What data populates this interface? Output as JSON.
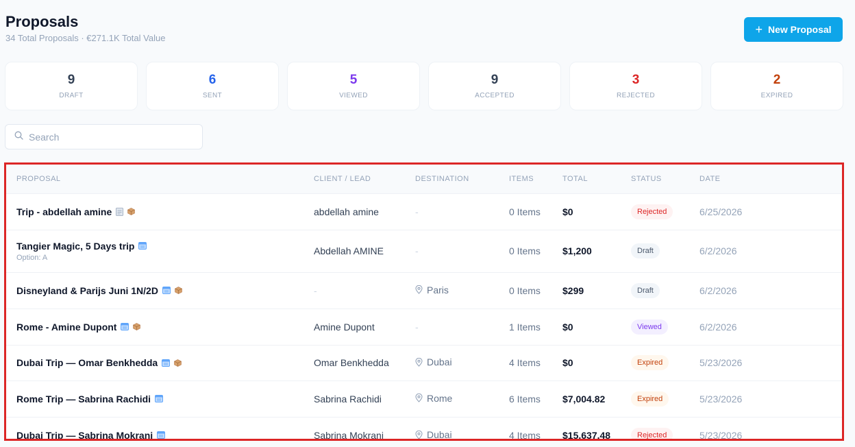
{
  "header": {
    "title": "Proposals",
    "subtitle": "34 Total Proposals · €271.1K Total Value",
    "new_button_label": "New Proposal",
    "new_button_icon": "plus-icon"
  },
  "stats": [
    {
      "value": "9",
      "label": "DRAFT",
      "color": "#334155"
    },
    {
      "value": "6",
      "label": "SENT",
      "color": "#2563eb"
    },
    {
      "value": "5",
      "label": "VIEWED",
      "color": "#7c3aed"
    },
    {
      "value": "9",
      "label": "ACCEPTED",
      "color": "#334155"
    },
    {
      "value": "3",
      "label": "REJECTED",
      "color": "#dc2626"
    },
    {
      "value": "2",
      "label": "EXPIRED",
      "color": "#c2410c"
    }
  ],
  "search": {
    "placeholder": "Search",
    "value": "",
    "icon": "search-icon"
  },
  "table": {
    "columns": [
      "PROPOSAL",
      "CLIENT / LEAD",
      "DESTINATION",
      "ITEMS",
      "TOTAL",
      "STATUS",
      "DATE"
    ],
    "rows": [
      {
        "name": "Trip - abdellah amine",
        "option": "",
        "icons": [
          "note-icon",
          "box-icon"
        ],
        "client": "abdellah amine",
        "destination": "-",
        "items": "0 Items",
        "total": "$0",
        "status": "Rejected",
        "date": "6/25/2026"
      },
      {
        "name": "Tangier Magic, 5 Days trip",
        "option": "Option: A",
        "icons": [
          "calendar-icon"
        ],
        "client": "Abdellah AMINE",
        "destination": "-",
        "items": "0 Items",
        "total": "$1,200",
        "status": "Draft",
        "date": "6/2/2026"
      },
      {
        "name": "Disneyland & Parijs Juni 1N/2D",
        "option": "",
        "icons": [
          "calendar-icon",
          "box-icon"
        ],
        "client": "-",
        "destination": "Paris",
        "items": "0 Items",
        "total": "$299",
        "status": "Draft",
        "date": "6/2/2026"
      },
      {
        "name": "Rome - Amine Dupont",
        "option": "",
        "icons": [
          "calendar-icon",
          "box-icon"
        ],
        "client": "Amine Dupont",
        "destination": "-",
        "items": "1 Items",
        "total": "$0",
        "status": "Viewed",
        "date": "6/2/2026"
      },
      {
        "name": "Dubai Trip — Omar Benkhedda",
        "option": "",
        "icons": [
          "calendar-icon",
          "box-icon"
        ],
        "client": "Omar Benkhedda",
        "destination": "Dubai",
        "items": "4 Items",
        "total": "$0",
        "status": "Expired",
        "date": "5/23/2026"
      },
      {
        "name": "Rome Trip — Sabrina Rachidi",
        "option": "",
        "icons": [
          "calendar-icon"
        ],
        "client": "Sabrina Rachidi",
        "destination": "Rome",
        "items": "6 Items",
        "total": "$7,004.82",
        "status": "Expired",
        "date": "5/23/2026"
      },
      {
        "name": "Dubai Trip — Sabrina Mokrani",
        "option": "",
        "icons": [
          "calendar-icon"
        ],
        "client": "Sabrina Mokrani",
        "destination": "Dubai",
        "items": "4 Items",
        "total": "$15,637.48",
        "status": "Rejected",
        "date": "5/23/2026"
      }
    ]
  },
  "status_styles": {
    "Rejected": {
      "bg": "#fef2f2",
      "fg": "#dc2626"
    },
    "Draft": {
      "bg": "#f1f5f9",
      "fg": "#475569"
    },
    "Viewed": {
      "bg": "#f3efff",
      "fg": "#7c3aed"
    },
    "Expired": {
      "bg": "#fff7ed",
      "fg": "#c2410c"
    }
  }
}
